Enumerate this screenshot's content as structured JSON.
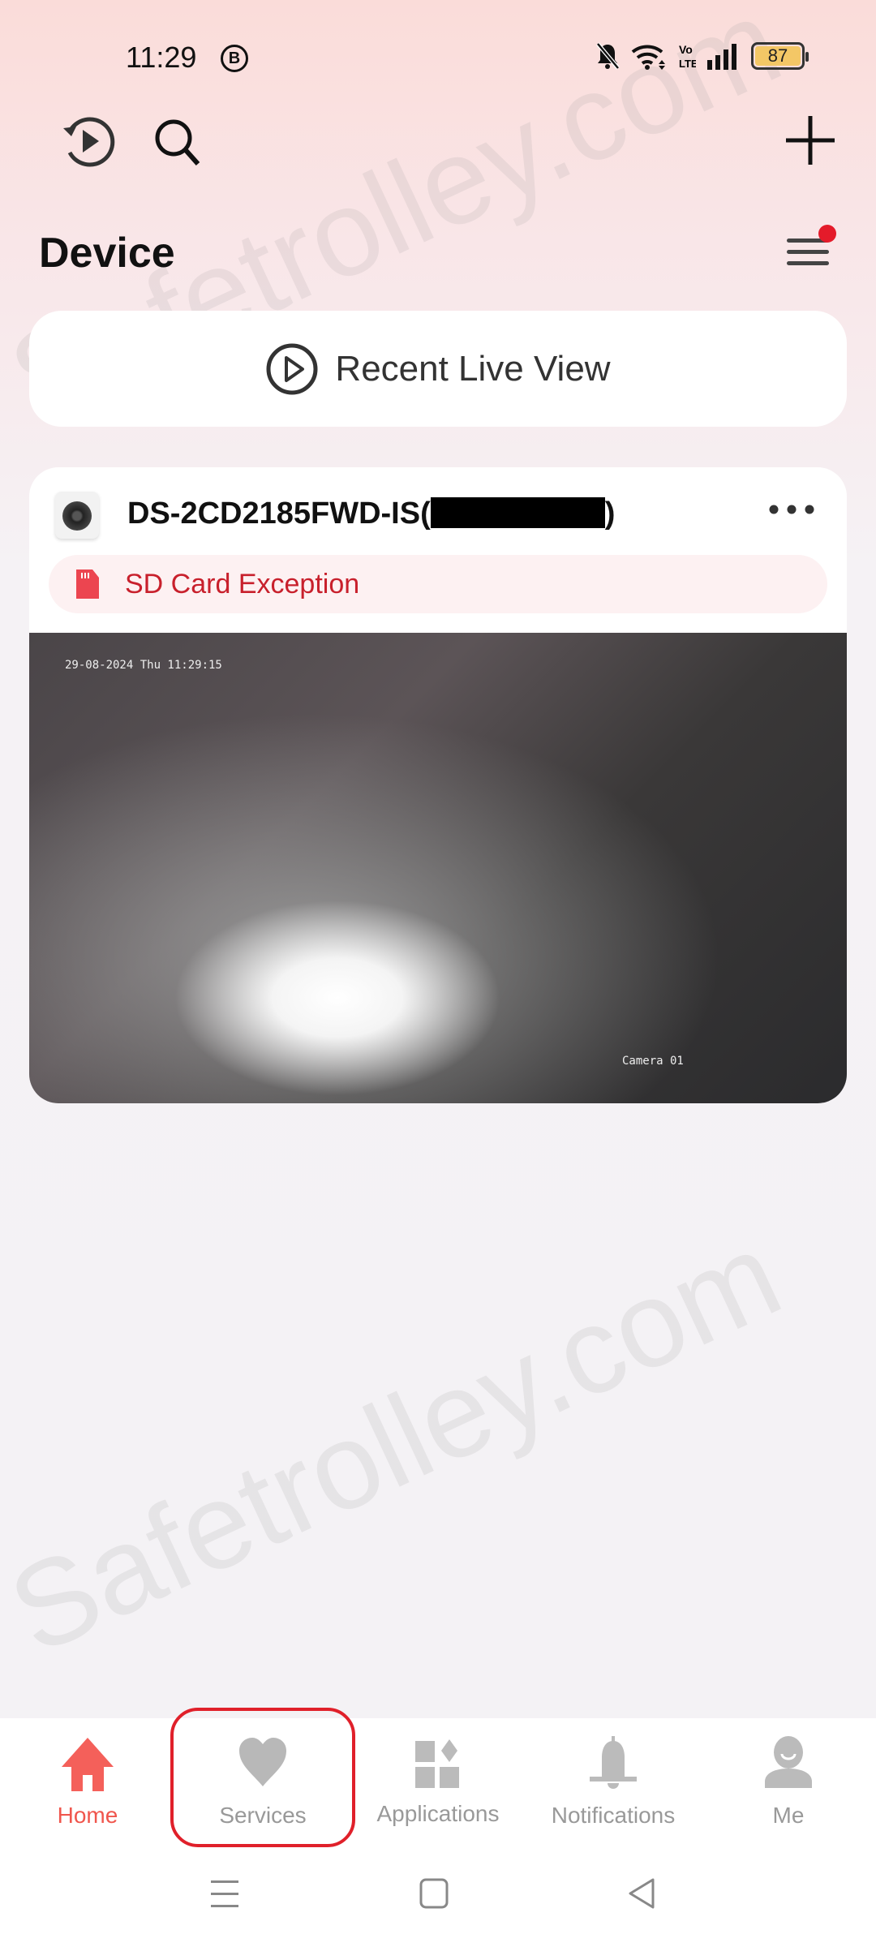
{
  "status_bar": {
    "time": "11:29",
    "badge": "B",
    "battery": "87",
    "icons": [
      "mute-bell-icon",
      "wifi-icon",
      "volte-icon",
      "signal-icon",
      "battery-icon"
    ]
  },
  "toolbar": {
    "icons": [
      "history-play-icon",
      "search-icon",
      "plus-icon"
    ]
  },
  "page": {
    "title": "Device"
  },
  "recent_live_view": {
    "label": "Recent Live View"
  },
  "device": {
    "name": "DS-2CD2185FWD-IS(",
    "name_suffix": ")",
    "alert": "SD Card Exception",
    "osd_time": "29-08-2024 Thu 11:29:15",
    "osd_camera": "Camera 01"
  },
  "bottom_nav": {
    "items": [
      {
        "label": "Home",
        "icon": "home-icon",
        "active": true
      },
      {
        "label": "Services",
        "icon": "heart-icon"
      },
      {
        "label": "Applications",
        "icon": "apps-icon"
      },
      {
        "label": "Notifications",
        "icon": "bell-icon"
      },
      {
        "label": "Me",
        "icon": "user-icon"
      }
    ]
  },
  "colors": {
    "accent": "#f0564d",
    "alert": "#c8202c",
    "highlight": "#e0202a"
  },
  "watermark": "Safetrolley.com"
}
